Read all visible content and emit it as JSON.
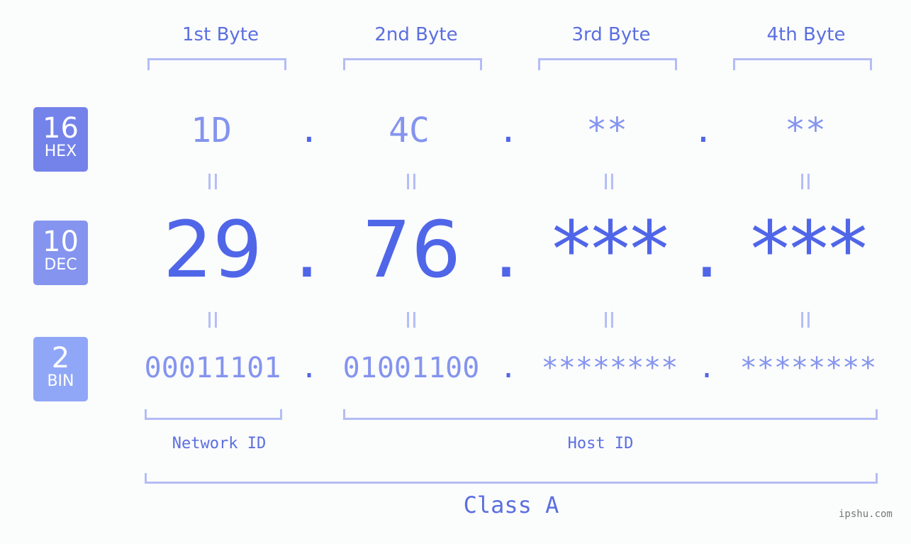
{
  "headers": [
    "1st Byte",
    "2nd Byte",
    "3rd Byte",
    "4th Byte"
  ],
  "badges": [
    {
      "num": "16",
      "label": "HEX",
      "color": "#7483ea"
    },
    {
      "num": "10",
      "label": "DEC",
      "color": "#8494ef"
    },
    {
      "num": "2",
      "label": "BIN",
      "color": "#90a7f8"
    }
  ],
  "hex": [
    "1D",
    "4C",
    "**",
    "**"
  ],
  "dec": [
    "29",
    "76",
    "***",
    "***"
  ],
  "bin": [
    "00011101",
    "01001100",
    "********",
    "********"
  ],
  "separator": ".",
  "equals": "II",
  "network_label": "Network ID",
  "host_label": "Host ID",
  "class_label": "Class A",
  "watermark": "ipshu.com"
}
